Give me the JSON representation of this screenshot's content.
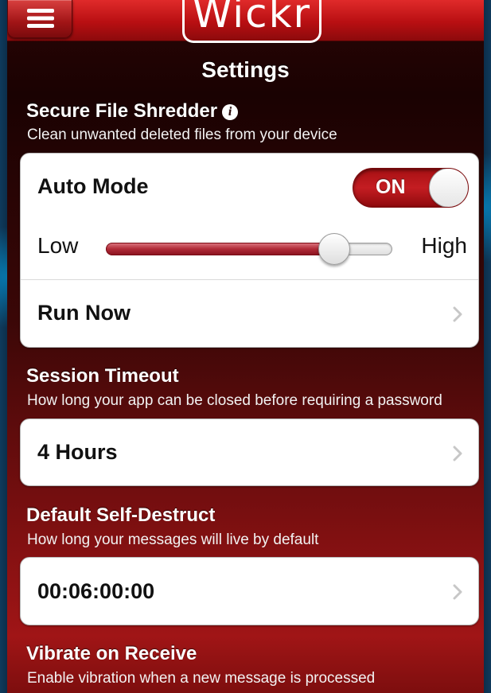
{
  "header": {
    "logo_text": "Wickr",
    "title": "Settings",
    "menu_icon": "hamburger-menu-icon"
  },
  "shredder": {
    "title": "Secure File Shredder",
    "info_icon": "info-icon",
    "info_glyph": "i",
    "description": "Clean unwanted deleted files from your device",
    "auto_mode_label": "Auto Mode",
    "auto_mode_state": "ON",
    "slider_low_label": "Low",
    "slider_high_label": "High",
    "slider_level": 0.8,
    "run_now_label": "Run Now"
  },
  "session_timeout": {
    "title": "Session Timeout",
    "description": "How long your app can be closed before requiring a password",
    "value": "4 Hours"
  },
  "self_destruct": {
    "title": "Default Self-Destruct",
    "description": "How long your messages will live by default",
    "value": "00:06:00:00"
  },
  "vibrate": {
    "title": "Vibrate on Receive",
    "description": "Enable vibration when a new message is processed"
  },
  "colors": {
    "header_red": "#c41d22",
    "toggle_on": "#b3141a",
    "slider_fill": "#b02a37",
    "group_bg": "#ffffff"
  }
}
